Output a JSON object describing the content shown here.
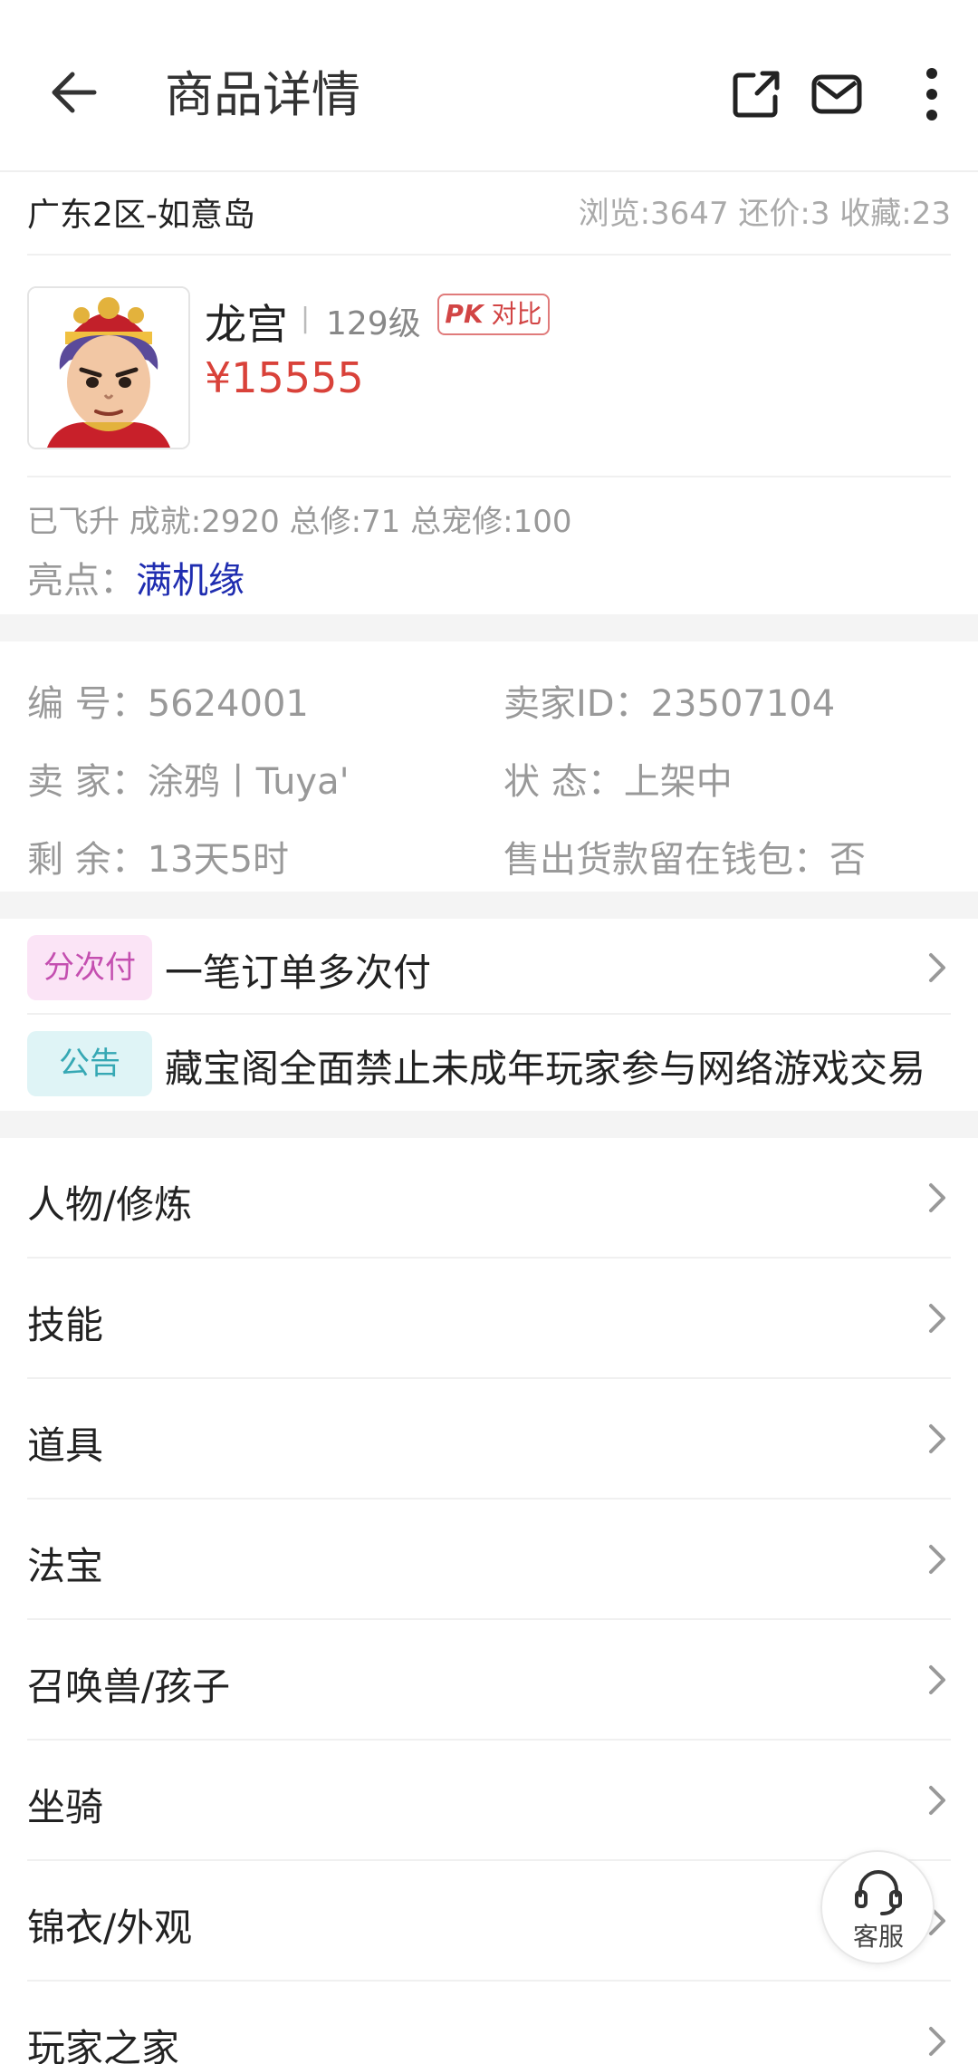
{
  "header": {
    "title": "商品详情"
  },
  "summary": {
    "server": "广东2区-如意岛",
    "stats": "浏览:3647 还价:3 收藏:23"
  },
  "character": {
    "name": "龙宫",
    "separator": "|",
    "level": "129级",
    "pk_badge": "PK",
    "compare_label": "对比",
    "price": "¥15555"
  },
  "attributes": "已飞升 成就:2920 总修:71 总宠修:100",
  "highlight": {
    "label": "亮点：",
    "value": "满机缘"
  },
  "info": {
    "id": "编  号：5624001",
    "seller_id": "卖家ID：23507104",
    "seller": "卖  家：涂鸦丨Tuya'",
    "status": "状  态：上架中",
    "remaining": "剩  余：13天5时",
    "wallet": "售出货款留在钱包：否"
  },
  "promos": [
    {
      "tag": "分次付",
      "text": "一笔订单多次付"
    },
    {
      "tag": "公告",
      "text": "藏宝阁全面禁止未成年玩家参与网络游戏交易"
    }
  ],
  "menu": [
    {
      "label": "人物/修炼"
    },
    {
      "label": "技能"
    },
    {
      "label": "道具"
    },
    {
      "label": "法宝"
    },
    {
      "label": "召唤兽/孩子"
    },
    {
      "label": "坐骑"
    },
    {
      "label": "锦衣/外观"
    },
    {
      "label": "玩家之家"
    }
  ],
  "service": {
    "label": "客服"
  },
  "colors": {
    "price": "#d9423a",
    "highlight": "#1f2db0",
    "tag_pink": "#c44fb0",
    "tag_cyan": "#36a8b4"
  },
  "icons": [
    "back-arrow-icon",
    "share-icon",
    "mail-icon",
    "more-icon",
    "chevron-right-icon",
    "headset-icon"
  ]
}
